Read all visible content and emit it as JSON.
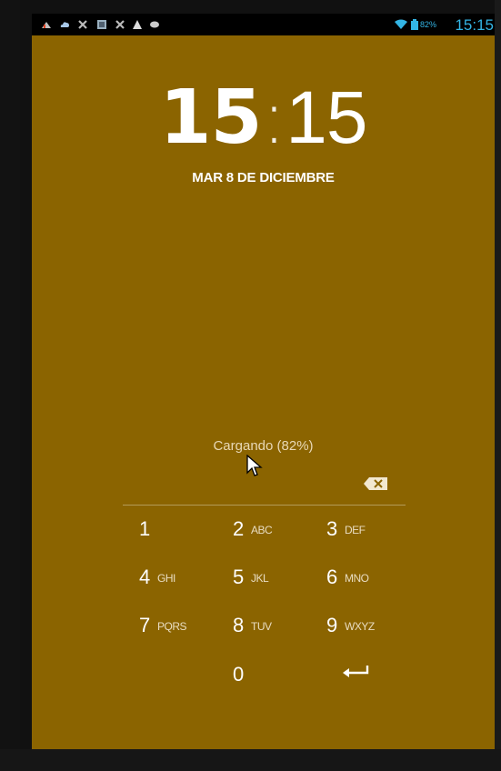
{
  "status_bar": {
    "left_icons": [
      "notification-icon",
      "cloud-icon",
      "sync-icon",
      "gallery-icon",
      "sync-icon",
      "warning-icon",
      "chat-icon"
    ],
    "battery_percent": "82%",
    "time": "15:15",
    "accent_color": "#33b5e5"
  },
  "lockscreen": {
    "clock_hours": "15",
    "clock_separator": ":",
    "clock_minutes": "15",
    "date": "MAR 8 DE DICIEMBRE",
    "charging_text": "Cargando (82%)",
    "background_color": "#8b6400"
  },
  "keypad": {
    "keys": [
      {
        "digit": "1",
        "letters": ""
      },
      {
        "digit": "2",
        "letters": "ABC"
      },
      {
        "digit": "3",
        "letters": "DEF"
      },
      {
        "digit": "4",
        "letters": "GHI"
      },
      {
        "digit": "5",
        "letters": "JKL"
      },
      {
        "digit": "6",
        "letters": "MNO"
      },
      {
        "digit": "7",
        "letters": "PQRS"
      },
      {
        "digit": "8",
        "letters": "TUV"
      },
      {
        "digit": "9",
        "letters": "WXYZ"
      },
      {
        "digit": "0",
        "letters": ""
      }
    ],
    "enter_icon": "enter-arrow-icon",
    "backspace_icon": "backspace-icon"
  }
}
